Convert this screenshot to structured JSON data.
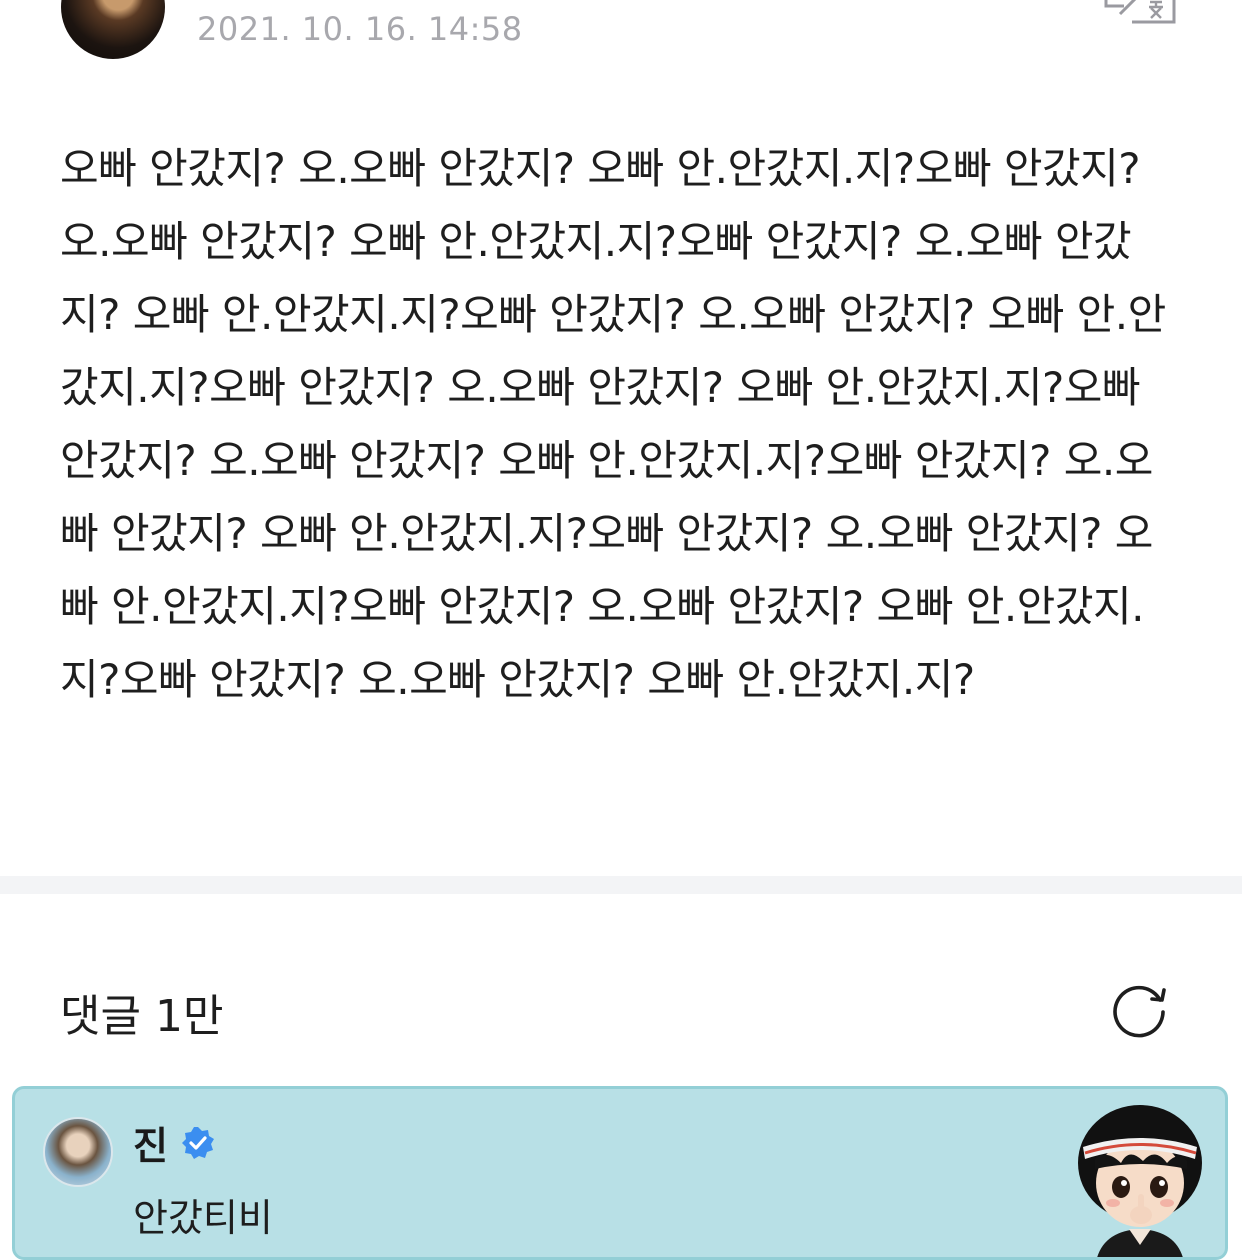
{
  "post": {
    "timestamp": "2021. 10. 16. 14:58",
    "translate_icon": "translate-icon",
    "body": "오빠 안갔지? 오.오빠 안갔지? 오빠 안.안갔지.지?오빠 안갔지? 오.오빠 안갔지? 오빠 안.안갔지.지?오빠 안갔지? 오.오빠 안갔지? 오빠 안.안갔지.지?오빠 안갔지? 오.오빠 안갔지? 오빠 안.안갔지.지?오빠 안갔지? 오.오빠 안갔지? 오빠 안.안갔지.지?오빠 안갔지? 오.오빠 안갔지? 오빠 안.안갔지.지?오빠 안갔지? 오.오빠 안갔지? 오빠 안.안갔지.지?오빠 안갔지? 오.오빠 안갔지? 오빠 안.안갔지.지?오빠 안갔지? 오.오빠 안갔지? 오빠 안.안갔지.지?오빠 안갔지? 오.오빠 안갔지? 오빠 안.안갔지.지?"
  },
  "comments": {
    "title": "댓글 1만",
    "refresh_icon": "refresh-icon"
  },
  "highlighted_comment": {
    "author": "진",
    "verified_icon": "verified-badge-icon",
    "text": "안갔티비",
    "background_color": "#b8e0e6",
    "border_color": "#93cfd6",
    "verified_color": "#3b8ef0"
  }
}
